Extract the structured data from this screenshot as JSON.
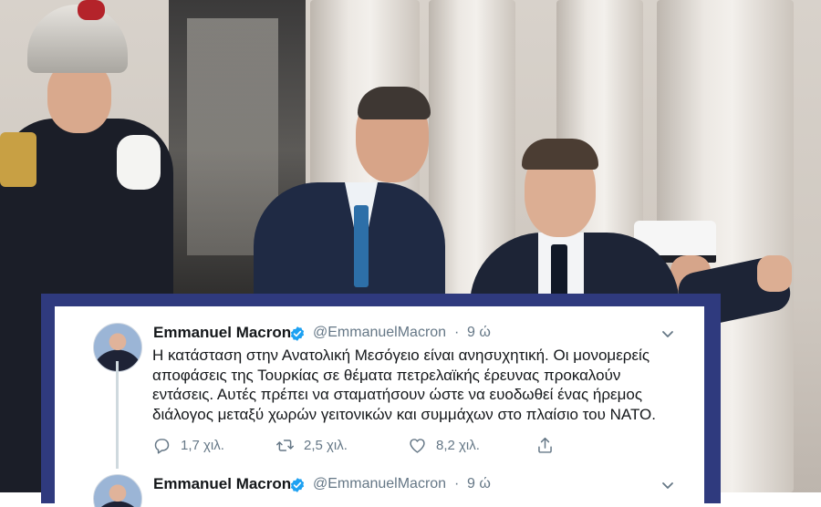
{
  "tweets": [
    {
      "name": "Emmanuel Macron",
      "handle": "@EmmanuelMacron",
      "separator": "·",
      "time": "9 ώ",
      "text_lines": [
        "Η κατάσταση στην Ανατολική Μεσόγειο είναι ανησυχητική. Οι μονομερείς",
        "αποφάσεις της Τουρκίας σε θέματα πετρελαϊκής έρευνας προκαλούν",
        "εντάσεις.  Αυτές πρέπει να σταματήσουν ώστε να ευοδωθεί ένας ήρεμος",
        "διάλογος μεταξύ χωρών γειτονικών και συμμάχων στο πλαίσιο του ΝΑΤΟ."
      ],
      "replies": "1,7 χιλ.",
      "retweets": "2,5 χιλ.",
      "likes": "8,2 χιλ."
    },
    {
      "name": "Emmanuel Macron",
      "handle": "@EmmanuelMacron",
      "separator": "·",
      "time": "9 ώ"
    }
  ],
  "icons": {
    "verified": "verified-badge-icon",
    "menu": "chevron-down-icon",
    "reply": "reply-icon",
    "retweet": "retweet-icon",
    "like": "heart-icon",
    "share": "share-icon"
  },
  "colors": {
    "frame": "#2f3a7e",
    "verified": "#1da1f2",
    "secondary_text": "#657786",
    "primary_text": "#14171a"
  }
}
